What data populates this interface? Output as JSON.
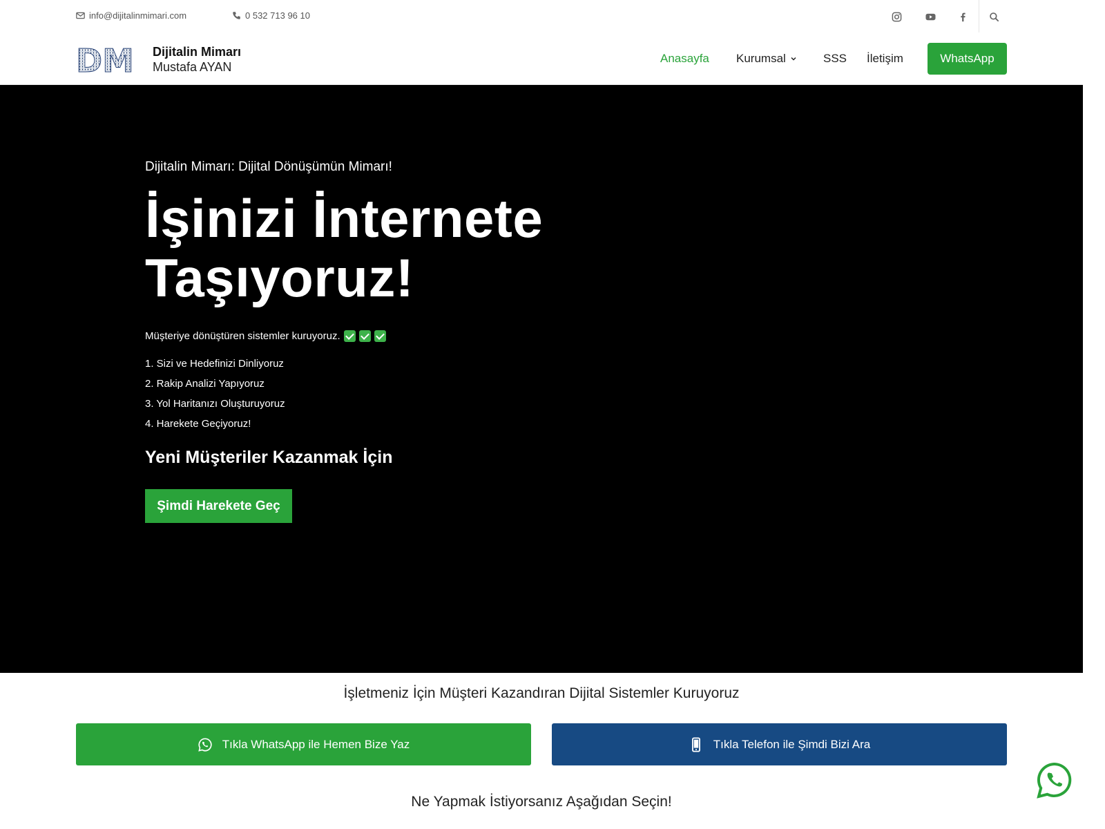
{
  "topbar": {
    "email": "info@dijitalinmimari.com",
    "phone": "0 532 713 96 10",
    "social": [
      "instagram-icon",
      "youtube-icon",
      "facebook-icon",
      "search-icon"
    ]
  },
  "header": {
    "logo_letters": "DM",
    "brand_name": "Dijitalin Mimarı",
    "brand_sub": "Mustafa AYAN",
    "nav": [
      {
        "label": "Anasayfa",
        "active": true
      },
      {
        "label": "Kurumsal",
        "dropdown": true
      },
      {
        "label": "SSS"
      },
      {
        "label": "İletişim"
      }
    ],
    "cta_label": "WhatsApp"
  },
  "hero": {
    "kicker": "Dijitalin Mimarı: Dijital Dönüşümün Mimarı!",
    "title_line1": "İşinizi İnternete",
    "title_line2": "Taşıyoruz!",
    "description": "Müşteriye dönüştüren sistemler kuruyoruz.",
    "steps": [
      "1. Sizi ve Hedefinizi Dinliyoruz",
      "2. Rakip Analizi Yapıyoruz",
      "3. Yol Haritanızı Oluşturuyoruz",
      "4. Harekete Geçiyoruz!"
    ],
    "subheading": "Yeni Müşteriler Kazanmak İçin",
    "cta_label": "Şimdi Harekete Geç"
  },
  "section": {
    "title": "İşletmeniz İçin Müşteri Kazandıran Dijital Sistemler Kuruyoruz",
    "whatsapp_button": "Tıkla WhatsApp ile Hemen Bize Yaz",
    "phone_button": "Tıkla Telefon ile Şimdi Bizi Ara",
    "choose_title": "Ne Yapmak İstiyorsanız Aşağıdan Seçin!"
  },
  "colors": {
    "accent": "#2aa33a",
    "phone_button": "#174a83",
    "hero_bg": "#000000"
  }
}
